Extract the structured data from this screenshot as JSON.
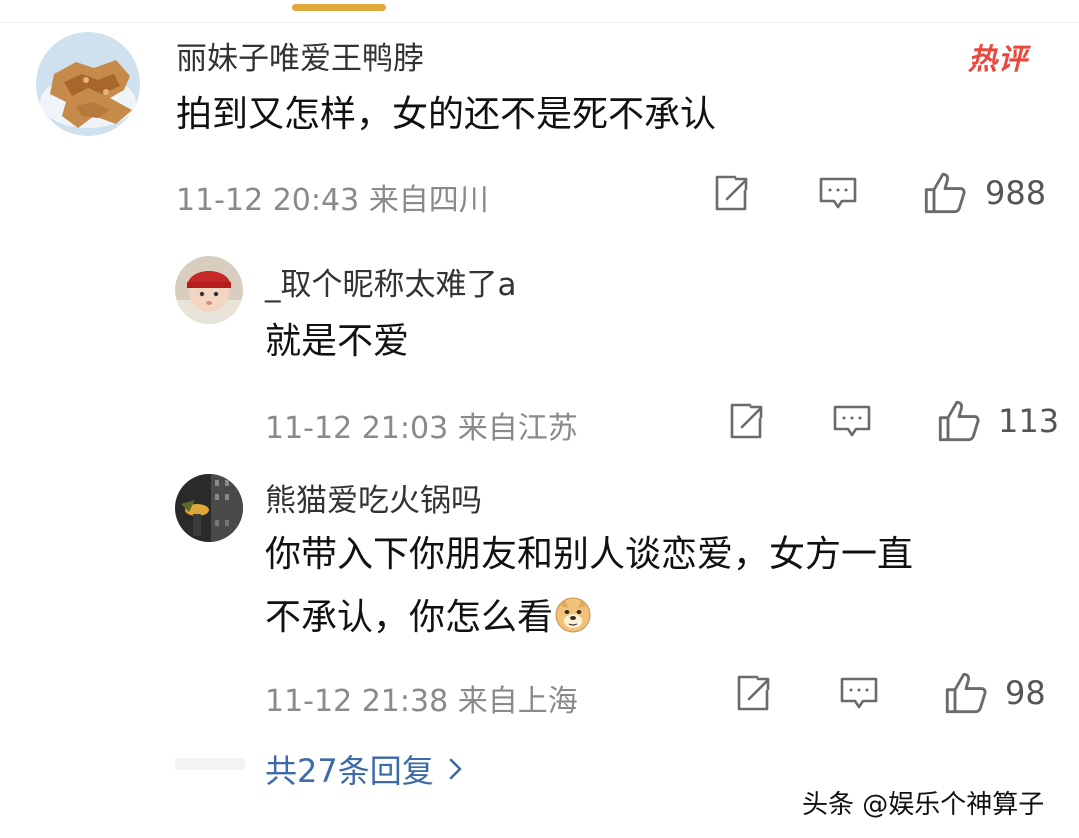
{
  "comments": [
    {
      "username": "丽妹子唯爱王鸭脖",
      "badge": "热评",
      "text": "拍到又怎样，女的还不是死不承认",
      "time": "11-12 20:43",
      "location": "来自四川",
      "likes": "988",
      "avatar": "food-photo"
    },
    {
      "username": "_取个昵称太难了a",
      "text": "就是不爱",
      "time": "11-12 21:03",
      "location": "来自江苏",
      "likes": "113",
      "avatar": "baby-photo"
    },
    {
      "username": "熊猫爱吃火锅吗",
      "text_line1": "你带入下你朋友和别人谈恋爱，女方一直",
      "text_line2": "不承认，你怎么看",
      "emoji": "doge-emoji",
      "time": "11-12 21:38",
      "location": "来自上海",
      "likes": "98",
      "avatar": "night-scene-photo"
    }
  ],
  "replies_link": "共27条回复",
  "watermark": "头条 @娱乐个神算子",
  "icons": {
    "share": "share-icon",
    "comment": "comment-icon",
    "like": "thumbs-up-icon",
    "chevron": "chevron-right-icon"
  },
  "colors": {
    "hot_badge": "#e8483d",
    "link": "#3d6aa9",
    "meta": "#8a8a8a",
    "top_indicator": "#e2a73a"
  }
}
